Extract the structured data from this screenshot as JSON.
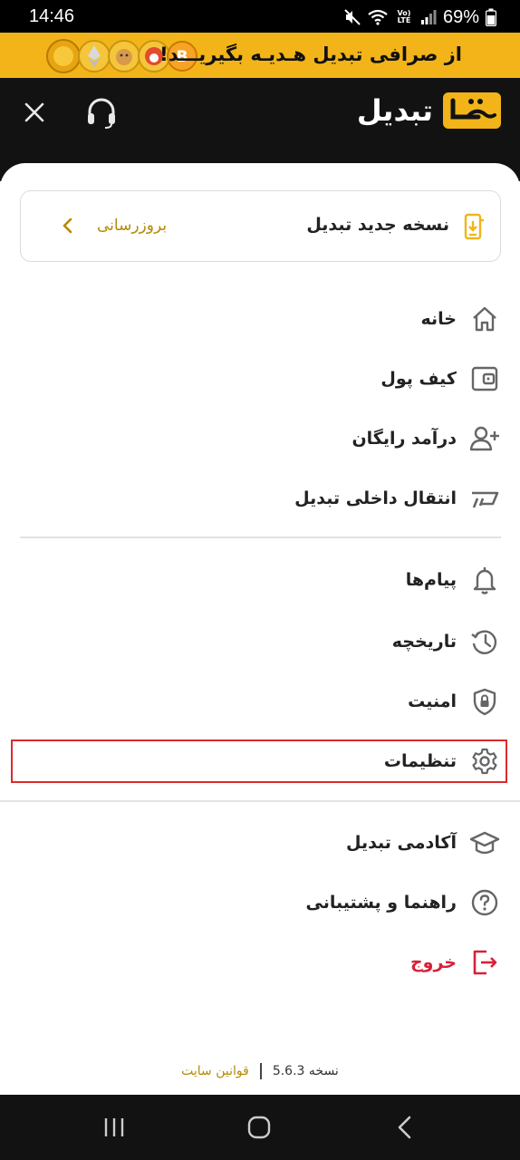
{
  "status_bar": {
    "time": "14:46",
    "network_badge": "Vo) LTE",
    "battery": "69%"
  },
  "promo": {
    "text": "از صرافی تبدیل هـدیـه بگیریـــد!",
    "coin_icons": [
      "gold-coin-icon",
      "ethereum-coin-icon",
      "doge-coin-icon",
      "shiba-coin-icon",
      "bitcoin-coin-icon"
    ]
  },
  "header": {
    "brand_name": "تبدیل",
    "brand_color": "#f2b418"
  },
  "update_card": {
    "title": "نسخه جدید تبدیل",
    "action": "بروزرسانی"
  },
  "menu": {
    "group1": [
      {
        "label": "خانه",
        "icon": "home-icon"
      },
      {
        "label": "کیف پول",
        "icon": "wallet-icon"
      },
      {
        "label": "درآمد رایگان",
        "icon": "add-user-icon"
      },
      {
        "label": "انتقال داخلی تبدیل",
        "icon": "transfer-icon"
      }
    ],
    "group2": [
      {
        "label": "پیام‌ها",
        "icon": "bell-icon"
      },
      {
        "label": "تاریخچه",
        "icon": "history-icon"
      },
      {
        "label": "امنیت",
        "icon": "shield-lock-icon"
      },
      {
        "label": "تنظیمات",
        "icon": "gear-icon"
      }
    ],
    "group3": [
      {
        "label": "آکادمی تبدیل",
        "icon": "academy-icon"
      },
      {
        "label": "راهنما و پشتیبانی",
        "icon": "help-icon"
      },
      {
        "label": "خروج",
        "icon": "logout-icon"
      }
    ]
  },
  "footer": {
    "version": "نسخه 5.6.3",
    "rules": "قوانین سایت"
  },
  "colors": {
    "accent": "#f2b418",
    "link": "#b58a05",
    "danger": "#d8203a",
    "dark": "#121212"
  }
}
